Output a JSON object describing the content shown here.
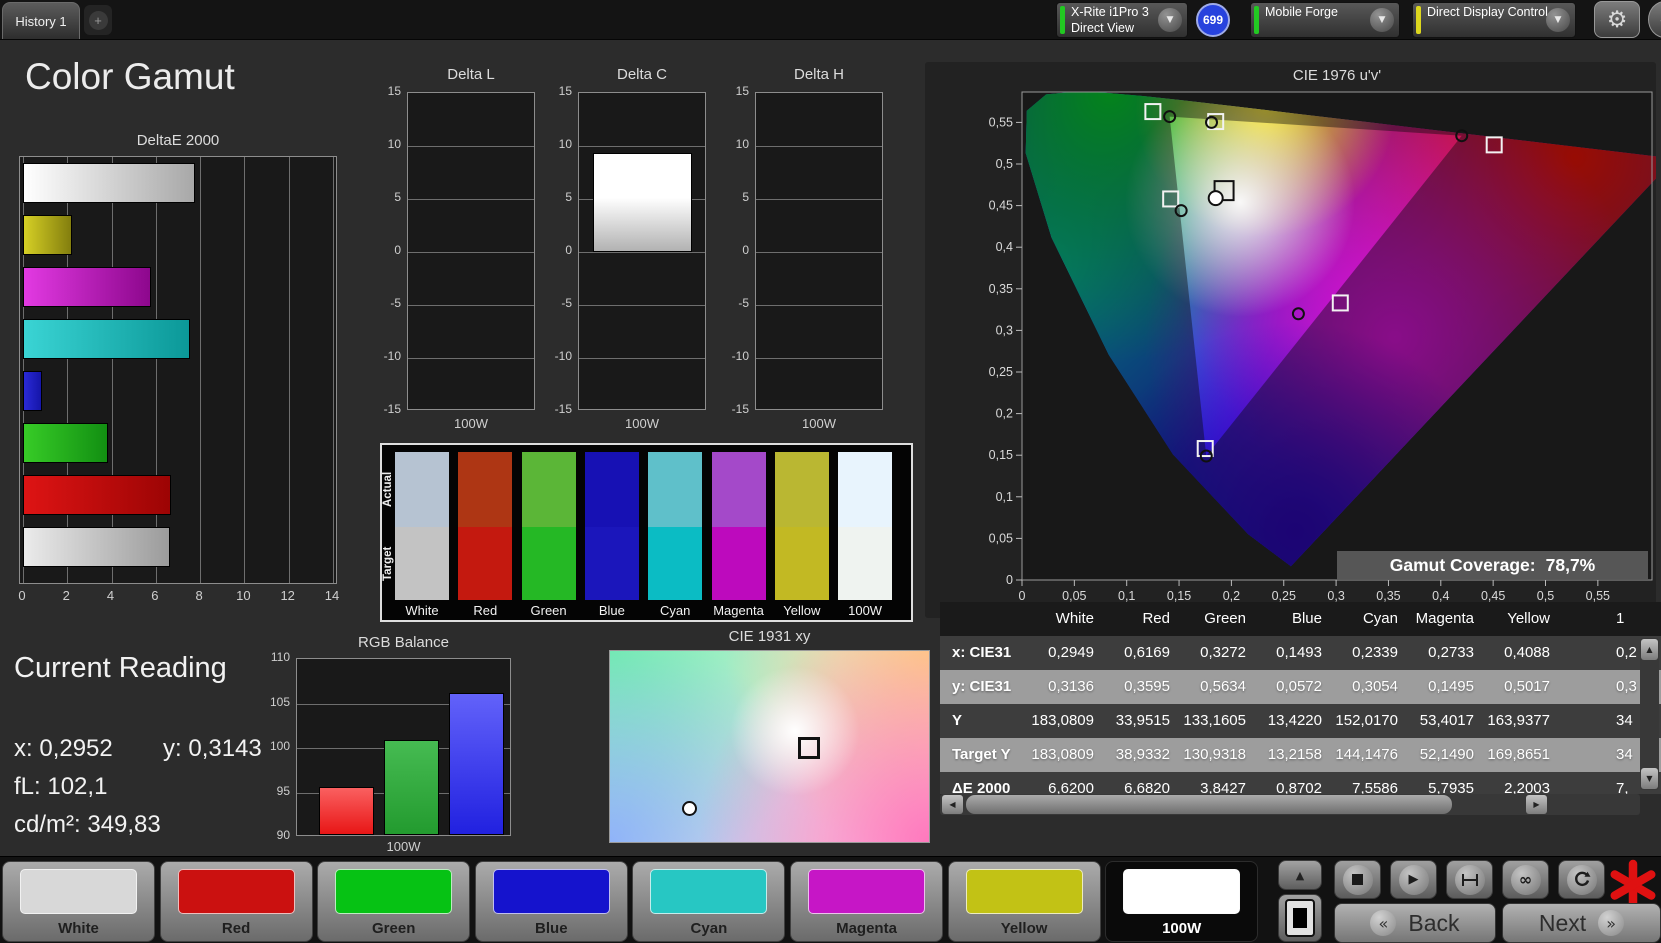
{
  "tab_bar": {
    "tab": "History 1",
    "add_button": "+"
  },
  "icons": {
    "chevron_down": "▼",
    "gear": "⚙",
    "collapse_left": "◀",
    "up_arrow": "▲",
    "down_arrow": "▼",
    "left_arrow": "◀",
    "right_arrow": "▶",
    "play": "▶",
    "stop": "■",
    "infinity": "∞",
    "back_chevron": "«",
    "next_chevron": "»"
  },
  "toolbar": {
    "meter_dropdown": {
      "line1": "X-Rite i1Pro 3",
      "line2": "Direct View",
      "status_color": "#22c922"
    },
    "badge": "699",
    "badge_color": "#2742dd",
    "pattern_dropdown": {
      "label": "Mobile Forge",
      "status_color": "#22c922"
    },
    "control_dropdown": {
      "label": "Direct Display Control",
      "status_color": "#ddd71e"
    }
  },
  "page_title": "Color Gamut",
  "current_reading": {
    "title": "Current Reading",
    "x_label": "x:",
    "x_value": "0,2952",
    "y_label": "y:",
    "y_value": "0,3143",
    "fl_label": "fL:",
    "fl_value": "102,1",
    "cd_label": "cd/m²:",
    "cd_value": "349,83"
  },
  "gamut_coverage": {
    "label": "Gamut Coverage:",
    "value": "78,7%"
  },
  "swatch_panel": {
    "row_labels": [
      "Actual",
      "Target"
    ],
    "columns": [
      {
        "label": "White",
        "actual": "#b6c3d2",
        "target": "#c3c3c3"
      },
      {
        "label": "Red",
        "actual": "#ae3614",
        "target": "#c4190f"
      },
      {
        "label": "Green",
        "actual": "#5bb637",
        "target": "#25b825"
      },
      {
        "label": "Blue",
        "actual": "#1711b4",
        "target": "#1b16bb"
      },
      {
        "label": "Cyan",
        "actual": "#5fc0ca",
        "target": "#0bbcc4"
      },
      {
        "label": "Magenta",
        "actual": "#a449c9",
        "target": "#bd0abd"
      },
      {
        "label": "Yellow",
        "actual": "#bab732",
        "target": "#c2b923"
      },
      {
        "label": "100W",
        "actual": "#e8f4fd",
        "target": "#eff3f0"
      }
    ]
  },
  "data_table": {
    "headers": [
      "White",
      "Red",
      "Green",
      "Blue",
      "Cyan",
      "Magenta",
      "Yellow"
    ],
    "clipped_header": "1",
    "rows": [
      {
        "label": "x: CIE31",
        "values": [
          "0,2949",
          "0,6169",
          "0,3272",
          "0,1493",
          "0,2339",
          "0,2733",
          "0,4088"
        ],
        "clipped_value": "0,2"
      },
      {
        "label": "y: CIE31",
        "values": [
          "0,3136",
          "0,3595",
          "0,5634",
          "0,0572",
          "0,3054",
          "0,1495",
          "0,5017"
        ],
        "clipped_value": "0,3"
      },
      {
        "label": "Y",
        "values": [
          "183,0809",
          "33,9515",
          "133,1605",
          "13,4220",
          "152,0170",
          "53,4017",
          "163,9377"
        ],
        "clipped_value": "34"
      },
      {
        "label": "Target Y",
        "values": [
          "183,0809",
          "38,9332",
          "130,9318",
          "13,2158",
          "144,1476",
          "52,1490",
          "169,8651"
        ],
        "clipped_value": "34"
      },
      {
        "label": "ΔE 2000",
        "values": [
          "6,6200",
          "6,6820",
          "3,8427",
          "0,8702",
          "7,5586",
          "5,7935",
          "2,2003"
        ],
        "clipped_value": "7,"
      }
    ]
  },
  "bottom_bar": {
    "patches": [
      {
        "label": "White",
        "color": "#d8d8d8",
        "selected": false
      },
      {
        "label": "Red",
        "color": "#cb1110",
        "selected": false
      },
      {
        "label": "Green",
        "color": "#06c214",
        "selected": false
      },
      {
        "label": "Blue",
        "color": "#1513cd",
        "selected": false
      },
      {
        "label": "Cyan",
        "color": "#27c7c3",
        "selected": false
      },
      {
        "label": "Magenta",
        "color": "#c616c6",
        "selected": false
      },
      {
        "label": "Yellow",
        "color": "#c2c215",
        "selected": false
      },
      {
        "label": "100W",
        "color": "#ffffff",
        "selected": true
      }
    ],
    "media_buttons": [
      "stop",
      "play",
      "marker",
      "loop",
      "refresh"
    ],
    "back_label": "Back",
    "next_label": "Next"
  },
  "chart_data": [
    {
      "id": "deltae2000",
      "type": "bar",
      "orientation": "horizontal",
      "title": "DeltaE 2000",
      "categories": [
        "100W",
        "Yellow",
        "Magenta",
        "Cyan",
        "Blue",
        "Green",
        "Red",
        "White"
      ],
      "values": [
        7.78,
        2.2,
        5.79,
        7.56,
        0.87,
        3.84,
        6.68,
        6.62
      ],
      "xlim": [
        0,
        14
      ],
      "xticks": [
        0,
        2,
        4,
        6,
        8,
        10,
        12,
        14
      ],
      "grid": true,
      "bar_colors": [
        [
          "#ffffff",
          "#a8a8a8"
        ],
        [
          "#d6d025",
          "#837e0e"
        ],
        [
          "#e23ae2",
          "#8d078d"
        ],
        [
          "#3ad4d4",
          "#0b9898"
        ],
        [
          "#2a2ad8",
          "#1515a8"
        ],
        [
          "#37cc27",
          "#128f12"
        ],
        [
          "#de1414",
          "#9c0404"
        ],
        [
          "#ebebeb",
          "#9b9b9b"
        ]
      ]
    },
    {
      "id": "delta_l",
      "type": "bar",
      "title": "Delta L",
      "categories": [
        "100W"
      ],
      "values": [
        0
      ],
      "ylim": [
        -15,
        15
      ],
      "yticks": [
        15,
        10,
        5,
        0,
        -5,
        -10,
        -15
      ]
    },
    {
      "id": "delta_c",
      "type": "bar",
      "title": "Delta C",
      "categories": [
        "100W"
      ],
      "values": [
        9.3
      ],
      "ylim": [
        -15,
        15
      ],
      "yticks": [
        15,
        10,
        5,
        0,
        -5,
        -10,
        -15
      ]
    },
    {
      "id": "delta_h",
      "type": "bar",
      "title": "Delta H",
      "categories": [
        "100W"
      ],
      "values": [
        0
      ],
      "ylim": [
        -15,
        15
      ],
      "yticks": [
        15,
        10,
        5,
        0,
        -5,
        -10,
        -15
      ]
    },
    {
      "id": "rgb_balance",
      "type": "bar",
      "title": "RGB Balance",
      "categories": [
        "Red",
        "Green",
        "Blue"
      ],
      "values": [
        95.4,
        100.7,
        105.9
      ],
      "ylim": [
        90,
        110
      ],
      "yticks": [
        110,
        105,
        100,
        95,
        90
      ],
      "xlabel": "100W",
      "bar_colors": [
        "linear-gradient(#fa6060,#e81616)",
        "linear-gradient(#46bb52,#239b2f)",
        "linear-gradient(#6262fa,#2121e0)"
      ]
    },
    {
      "id": "cie1976",
      "type": "scatter",
      "title": "CIE 1976 u'v'",
      "xlim": [
        0,
        0.6
      ],
      "ylim": [
        0,
        0.586
      ],
      "xticks": {
        "values": [
          0,
          0.05,
          0.1,
          0.15,
          0.2,
          0.25,
          0.3,
          0.35,
          0.4,
          0.45,
          0.5,
          0.55
        ],
        "labels": [
          "0",
          "0,05",
          "0,1",
          "0,15",
          "0,2",
          "0,25",
          "0,3",
          "0,35",
          "0,4",
          "0,45",
          "0,5",
          "0,55"
        ]
      },
      "yticks": {
        "values": [
          0.55,
          0.5,
          0.45,
          0.4,
          0.35,
          0.3,
          0.25,
          0.2,
          0.15,
          0.1,
          0.05,
          0
        ],
        "labels": [
          "0,55",
          "0,5",
          "0,45",
          "0,4",
          "0,35",
          "0,3",
          "0,25",
          "0,2",
          "0,15",
          "0,1",
          "0,05",
          "0"
        ]
      },
      "series": [
        {
          "name": "target",
          "marker": "square",
          "points": [
            {
              "color": "white",
              "u": 0.193,
              "v": 0.468
            },
            {
              "color": "red",
              "u": 0.451,
              "v": 0.523
            },
            {
              "color": "green",
              "u": 0.125,
              "v": 0.563
            },
            {
              "color": "blue",
              "u": 0.175,
              "v": 0.158
            },
            {
              "color": "cyan",
              "u": 0.142,
              "v": 0.458
            },
            {
              "color": "magenta",
              "u": 0.304,
              "v": 0.333
            },
            {
              "color": "yellow",
              "u": 0.185,
              "v": 0.551
            }
          ]
        },
        {
          "name": "measured",
          "marker": "circle",
          "points": [
            {
              "color": "white",
              "u": 0.185,
              "v": 0.459
            },
            {
              "color": "red",
              "u": 0.42,
              "v": 0.534
            },
            {
              "color": "green",
              "u": 0.141,
              "v": 0.557
            },
            {
              "color": "blue",
              "u": 0.176,
              "v": 0.149
            },
            {
              "color": "cyan",
              "u": 0.152,
              "v": 0.444
            },
            {
              "color": "magenta",
              "u": 0.264,
              "v": 0.32
            },
            {
              "color": "yellow",
              "u": 0.181,
              "v": 0.55
            }
          ]
        }
      ],
      "annotation": "Gamut Coverage: 78,7%"
    },
    {
      "id": "cie1931",
      "type": "scatter",
      "title": "CIE 1931 xy",
      "series": [
        {
          "name": "target",
          "marker": "square",
          "points_rel": [
            [
              0.62,
              0.5
            ]
          ]
        },
        {
          "name": "measured",
          "marker": "circle",
          "points_rel": [
            [
              0.246,
              0.814
            ]
          ]
        }
      ]
    }
  ]
}
